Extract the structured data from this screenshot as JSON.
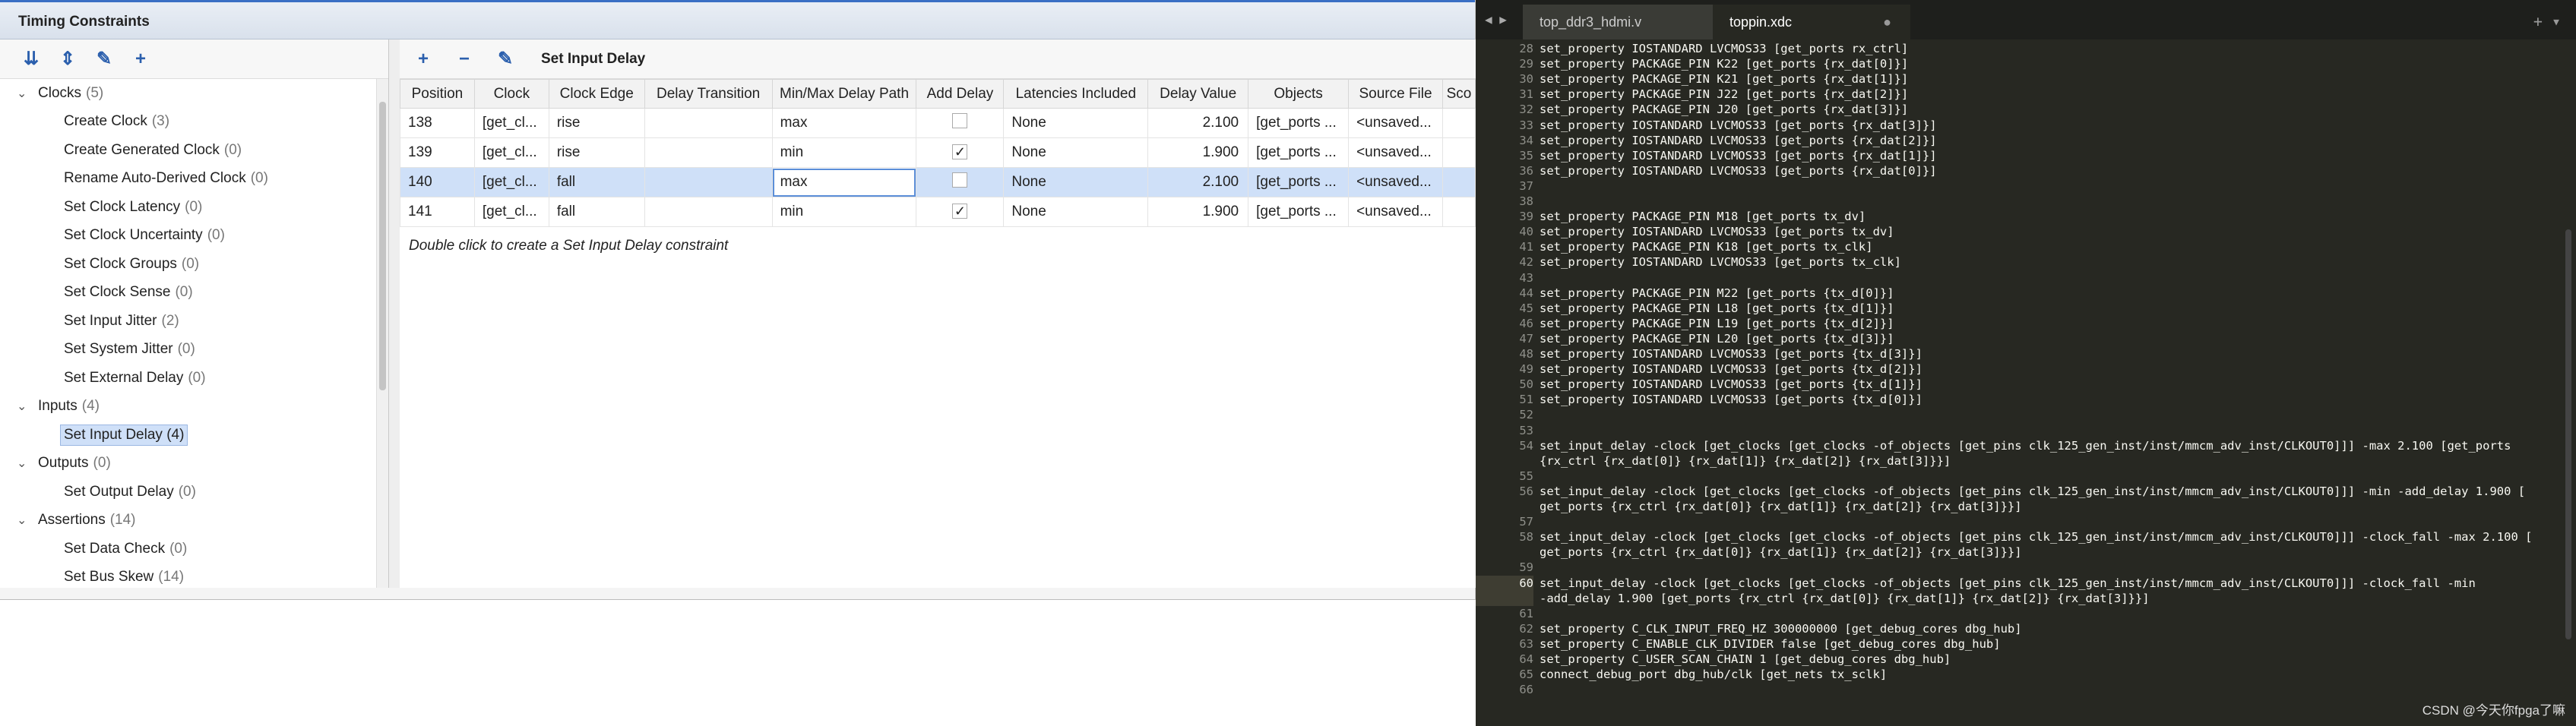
{
  "vivado": {
    "panel_title": "Timing Constraints",
    "toolbar2_title": "Set Input Delay",
    "tree": [
      {
        "kind": "cat",
        "label": "Clocks",
        "count": "(5)"
      },
      {
        "kind": "item",
        "label": "Create Clock",
        "count": "(3)"
      },
      {
        "kind": "item",
        "label": "Create Generated Clock",
        "count": "(0)"
      },
      {
        "kind": "item",
        "label": "Rename Auto-Derived Clock",
        "count": "(0)"
      },
      {
        "kind": "item",
        "label": "Set Clock Latency",
        "count": "(0)"
      },
      {
        "kind": "item",
        "label": "Set Clock Uncertainty",
        "count": "(0)"
      },
      {
        "kind": "item",
        "label": "Set Clock Groups",
        "count": "(0)"
      },
      {
        "kind": "item",
        "label": "Set Clock Sense",
        "count": "(0)"
      },
      {
        "kind": "item",
        "label": "Set Input Jitter",
        "count": "(2)"
      },
      {
        "kind": "item",
        "label": "Set System Jitter",
        "count": "(0)"
      },
      {
        "kind": "item",
        "label": "Set External Delay",
        "count": "(0)"
      },
      {
        "kind": "cat",
        "label": "Inputs",
        "count": "(4)"
      },
      {
        "kind": "item",
        "label": "Set Input Delay (4)",
        "count": "",
        "selected": true
      },
      {
        "kind": "cat",
        "label": "Outputs",
        "count": "(0)"
      },
      {
        "kind": "item",
        "label": "Set Output Delay",
        "count": "(0)"
      },
      {
        "kind": "cat",
        "label": "Assertions",
        "count": "(14)"
      },
      {
        "kind": "item",
        "label": "Set Data Check",
        "count": "(0)"
      },
      {
        "kind": "item",
        "label": "Set Bus Skew",
        "count": "(14)"
      }
    ],
    "columns": [
      "Position",
      "Clock",
      "Clock Edge",
      "Delay Transition",
      "Min/Max Delay Path",
      "Add Delay",
      "Latencies Included",
      "Delay Value",
      "Objects",
      "Source File",
      "Sco"
    ],
    "rows": [
      {
        "pos": "138",
        "clock": "[get_cl...",
        "edge": "rise",
        "trans": "",
        "minmax": "max",
        "add": false,
        "lat": "None",
        "val": "2.100",
        "obj": "[get_ports ...",
        "src": "<unsaved...",
        "sco": ""
      },
      {
        "pos": "139",
        "clock": "[get_cl...",
        "edge": "rise",
        "trans": "",
        "minmax": "min",
        "add": true,
        "lat": "None",
        "val": "1.900",
        "obj": "[get_ports ...",
        "src": "<unsaved...",
        "sco": ""
      },
      {
        "pos": "140",
        "clock": "[get_cl...",
        "edge": "fall",
        "trans": "",
        "minmax": "max",
        "add": false,
        "lat": "None",
        "val": "2.100",
        "obj": "[get_ports ...",
        "src": "<unsaved...",
        "sco": "",
        "selected": true
      },
      {
        "pos": "141",
        "clock": "[get_cl...",
        "edge": "fall",
        "trans": "",
        "minmax": "min",
        "add": true,
        "lat": "None",
        "val": "1.900",
        "obj": "[get_ports ...",
        "src": "<unsaved...",
        "sco": ""
      }
    ],
    "hint": "Double click to create a Set Input Delay constraint"
  },
  "editor": {
    "tabs": [
      {
        "label": "top_ddr3_hdmi.v",
        "close": "×",
        "active": false
      },
      {
        "label": "toppin.xdc",
        "close": "●",
        "active": true
      }
    ],
    "current_line": "60",
    "lines": [
      {
        "n": "28",
        "t": "set_property IOSTANDARD LVCMOS33 [get_ports rx_ctrl]"
      },
      {
        "n": "29",
        "t": "set_property PACKAGE_PIN K22 [get_ports {rx_dat[0]}]"
      },
      {
        "n": "30",
        "t": "set_property PACKAGE_PIN K21 [get_ports {rx_dat[1]}]"
      },
      {
        "n": "31",
        "t": "set_property PACKAGE_PIN J22 [get_ports {rx_dat[2]}]"
      },
      {
        "n": "32",
        "t": "set_property PACKAGE_PIN J20 [get_ports {rx_dat[3]}]"
      },
      {
        "n": "33",
        "t": "set_property IOSTANDARD LVCMOS33 [get_ports {rx_dat[3]}]"
      },
      {
        "n": "34",
        "t": "set_property IOSTANDARD LVCMOS33 [get_ports {rx_dat[2]}]"
      },
      {
        "n": "35",
        "t": "set_property IOSTANDARD LVCMOS33 [get_ports {rx_dat[1]}]"
      },
      {
        "n": "36",
        "t": "set_property IOSTANDARD LVCMOS33 [get_ports {rx_dat[0]}]"
      },
      {
        "n": "37",
        "t": ""
      },
      {
        "n": "38",
        "t": ""
      },
      {
        "n": "39",
        "t": "set_property PACKAGE_PIN M18 [get_ports tx_dv]"
      },
      {
        "n": "40",
        "t": "set_property IOSTANDARD LVCMOS33 [get_ports tx_dv]"
      },
      {
        "n": "41",
        "t": "set_property PACKAGE_PIN K18 [get_ports tx_clk]"
      },
      {
        "n": "42",
        "t": "set_property IOSTANDARD LVCMOS33 [get_ports tx_clk]"
      },
      {
        "n": "43",
        "t": ""
      },
      {
        "n": "44",
        "t": "set_property PACKAGE_PIN M22 [get_ports {tx_d[0]}]"
      },
      {
        "n": "45",
        "t": "set_property PACKAGE_PIN L18 [get_ports {tx_d[1]}]"
      },
      {
        "n": "46",
        "t": "set_property PACKAGE_PIN L19 [get_ports {tx_d[2]}]"
      },
      {
        "n": "47",
        "t": "set_property PACKAGE_PIN L20 [get_ports {tx_d[3]}]"
      },
      {
        "n": "48",
        "t": "set_property IOSTANDARD LVCMOS33 [get_ports {tx_d[3]}]"
      },
      {
        "n": "49",
        "t": "set_property IOSTANDARD LVCMOS33 [get_ports {tx_d[2]}]"
      },
      {
        "n": "50",
        "t": "set_property IOSTANDARD LVCMOS33 [get_ports {tx_d[1]}]"
      },
      {
        "n": "51",
        "t": "set_property IOSTANDARD LVCMOS33 [get_ports {tx_d[0]}]"
      },
      {
        "n": "52",
        "t": ""
      },
      {
        "n": "53",
        "t": ""
      },
      {
        "n": "54",
        "t": "set_input_delay -clock [get_clocks [get_clocks -of_objects [get_pins clk_125_gen_inst/inst/mmcm_adv_inst/CLKOUT0]]] -max 2.100 [get_ports"
      },
      {
        "n": "",
        "t": "{rx_ctrl {rx_dat[0]} {rx_dat[1]} {rx_dat[2]} {rx_dat[3]}}]"
      },
      {
        "n": "55",
        "t": ""
      },
      {
        "n": "56",
        "t": "set_input_delay -clock [get_clocks [get_clocks -of_objects [get_pins clk_125_gen_inst/inst/mmcm_adv_inst/CLKOUT0]]] -min -add_delay 1.900 ["
      },
      {
        "n": "",
        "t": "get_ports {rx_ctrl {rx_dat[0]} {rx_dat[1]} {rx_dat[2]} {rx_dat[3]}}]"
      },
      {
        "n": "57",
        "t": ""
      },
      {
        "n": "58",
        "t": "set_input_delay -clock [get_clocks [get_clocks -of_objects [get_pins clk_125_gen_inst/inst/mmcm_adv_inst/CLKOUT0]]] -clock_fall -max 2.100 ["
      },
      {
        "n": "",
        "t": "get_ports {rx_ctrl {rx_dat[0]} {rx_dat[1]} {rx_dat[2]} {rx_dat[3]}}]"
      },
      {
        "n": "59",
        "t": ""
      },
      {
        "n": "60",
        "t": "set_input_delay -clock [get_clocks [get_clocks -of_objects [get_pins clk_125_gen_inst/inst/mmcm_adv_inst/CLKOUT0]]] -clock_fall -min"
      },
      {
        "n": "",
        "t": "-add_delay 1.900 [get_ports {rx_ctrl {rx_dat[0]} {rx_dat[1]} {rx_dat[2]} {rx_dat[3]}}]"
      },
      {
        "n": "61",
        "t": ""
      },
      {
        "n": "62",
        "t": "set_property C_CLK_INPUT_FREQ_HZ 300000000 [get_debug_cores dbg_hub]"
      },
      {
        "n": "63",
        "t": "set_property C_ENABLE_CLK_DIVIDER false [get_debug_cores dbg_hub]"
      },
      {
        "n": "64",
        "t": "set_property C_USER_SCAN_CHAIN 1 [get_debug_cores dbg_hub]"
      },
      {
        "n": "65",
        "t": "connect_debug_port dbg_hub/clk [get_nets tx_sclk]"
      },
      {
        "n": "66",
        "t": ""
      }
    ],
    "watermark": "CSDN @今天你fpga了嘛"
  }
}
